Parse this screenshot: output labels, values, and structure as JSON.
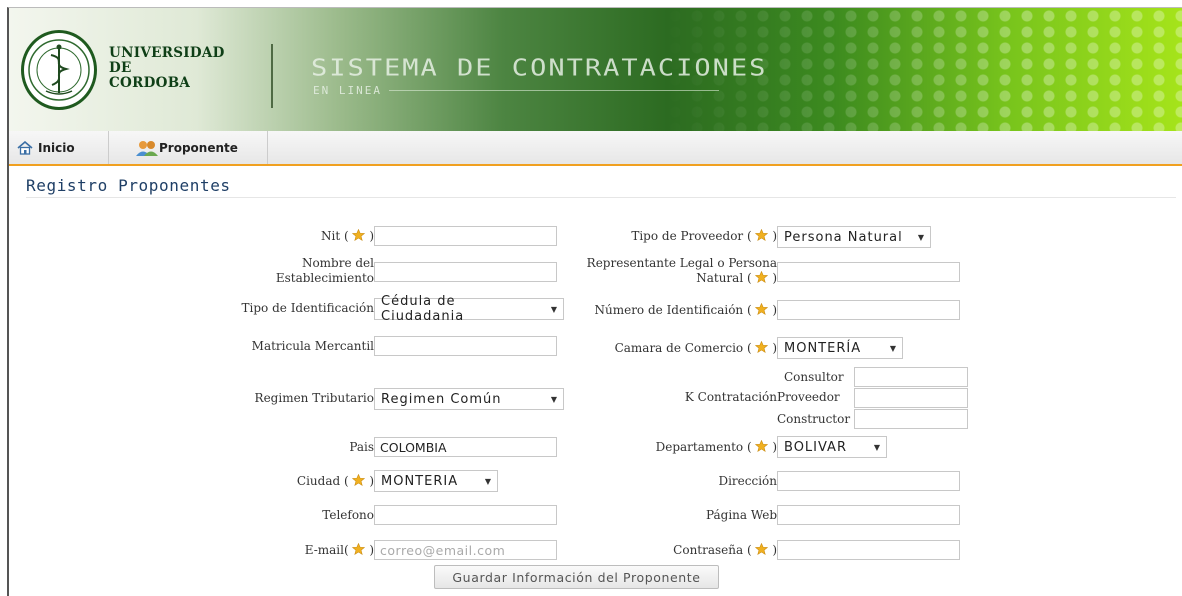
{
  "header": {
    "university_line1": "UNIVERSIDAD",
    "university_line2": "DE",
    "university_line3": "CORDOBA",
    "system_title": "SISTEMA DE CONTRATACIONES",
    "system_subtitle": "EN LINEA"
  },
  "menu": {
    "items": [
      {
        "label": "Inicio",
        "icon": "home-icon"
      },
      {
        "label": "Proponente",
        "icon": "users-icon"
      }
    ]
  },
  "page": {
    "title": "Registro Proponentes"
  },
  "form": {
    "nit_label": "Nit (",
    "nit_label_end": ")",
    "nit_value": "",
    "nombre_label_1": "Nombre del",
    "nombre_label_2": "Establecimiento",
    "nombre_value": "",
    "tipo_identificacion_label": "Tipo de Identificación",
    "tipo_identificacion_value": "Cédula de Ciudadania",
    "matricula_label": "Matricula Mercantil",
    "matricula_value": "",
    "regimen_label": "Regimen Tributario",
    "regimen_value": "Regimen Común",
    "pais_label": "Pais",
    "pais_value": "COLOMBIA",
    "ciudad_label": "Ciudad (",
    "ciudad_label_end": ")",
    "ciudad_value": "MONTERIA",
    "telefono_label": "Telefono",
    "telefono_value": "",
    "email_label": "E-mail(",
    "email_label_end": ")",
    "email_placeholder": "correo@email.com",
    "tipo_proveedor_label": "Tipo de Proveedor (",
    "tipo_proveedor_label_end": ")",
    "tipo_proveedor_value": "Persona Natural",
    "representante_label_1": "Representante Legal o Persona",
    "representante_label_2": "Natural (",
    "representante_label_end": ")",
    "representante_value": "",
    "numero_identificacion_label": "Número de Identificaión (",
    "numero_identificacion_label_end": ")",
    "numero_identificacion_value": "",
    "camara_label": "Camara de Comercio (",
    "camara_label_end": ")",
    "camara_value": "MONTERÍA",
    "k_contratacion_label": "K Contratación",
    "k_consultor_label": "Consultor",
    "k_proveedor_label": "Proveedor",
    "k_constructor_label": "Constructor",
    "departamento_label": "Departamento (",
    "departamento_label_end": ")",
    "departamento_value": "BOLIVAR",
    "direccion_label": "Dirección",
    "direccion_value": "",
    "pagina_web_label": "Página Web",
    "pagina_web_value": "",
    "contrasena_label": "Contraseña (",
    "contrasena_label_end": ")",
    "contrasena_value": "",
    "submit_label": "Guardar Información del Proponente"
  },
  "colors": {
    "menu_accent": "#f0a020",
    "title_color": "#1f3f66",
    "star_color": "#f0b020"
  }
}
